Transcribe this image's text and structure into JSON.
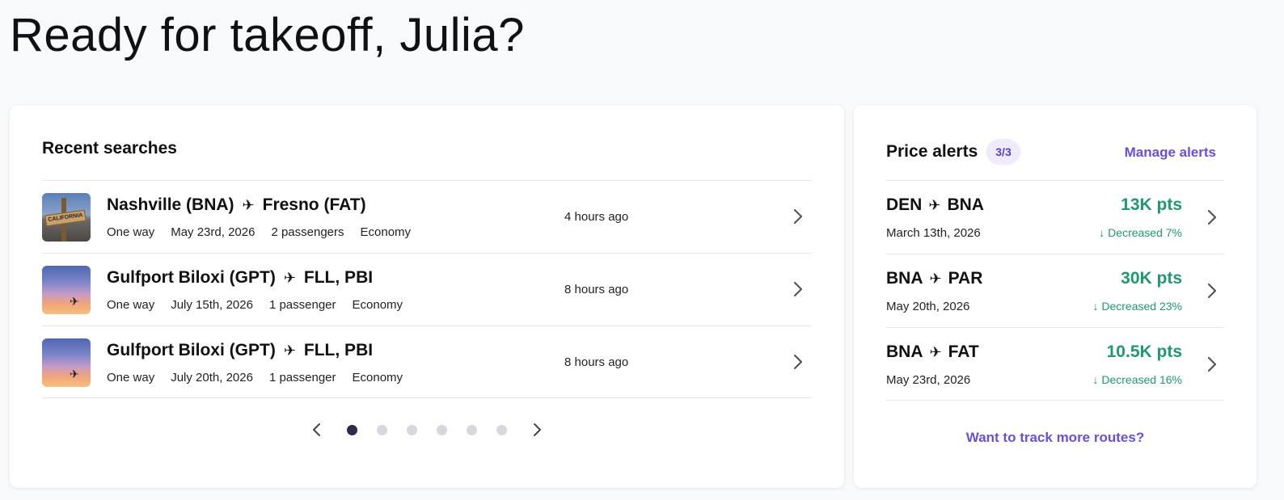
{
  "greeting": "Ready for takeoff, Julia?",
  "recent": {
    "title": "Recent searches",
    "searches": [
      {
        "origin": "Nashville (BNA)",
        "destination": "Fresno (FAT)",
        "trip": "One way",
        "date": "May 23rd, 2026",
        "passengers": "2 passengers",
        "cabin": "Economy",
        "ago": "4 hours ago",
        "image": "california-sign-photo",
        "sign_text": "CALIFORNIA"
      },
      {
        "origin": "Gulfport Biloxi (GPT)",
        "destination": "FLL, PBI",
        "trip": "One way",
        "date": "July 15th, 2026",
        "passengers": "1 passenger",
        "cabin": "Economy",
        "ago": "8 hours ago",
        "image": "sunset-plane-photo"
      },
      {
        "origin": "Gulfport Biloxi (GPT)",
        "destination": "FLL, PBI",
        "trip": "One way",
        "date": "July 20th, 2026",
        "passengers": "1 passenger",
        "cabin": "Economy",
        "ago": "8 hours ago",
        "image": "sunset-plane-photo"
      }
    ],
    "pager": {
      "pages": 6,
      "active": 1
    }
  },
  "alerts": {
    "title": "Price alerts",
    "count": "3/3",
    "manage_label": "Manage alerts",
    "items": [
      {
        "origin": "DEN",
        "destination": "BNA",
        "date": "March 13th, 2026",
        "price": "13K pts",
        "change": "↓ Decreased 7%"
      },
      {
        "origin": "BNA",
        "destination": "PAR",
        "date": "May 20th, 2026",
        "price": "30K pts",
        "change": "↓ Decreased 23%"
      },
      {
        "origin": "BNA",
        "destination": "FAT",
        "date": "May 23rd, 2026",
        "price": "10.5K pts",
        "change": "↓ Decreased 16%"
      }
    ],
    "track_label": "Want to track more routes?"
  },
  "icons": {
    "route_arrow": "airplane-icon",
    "row_chevron": "chevron-right-icon"
  },
  "colors": {
    "accent": "#6a4fd8",
    "price_green": "#1f9a6a",
    "active_dot": "#2d2b45"
  }
}
